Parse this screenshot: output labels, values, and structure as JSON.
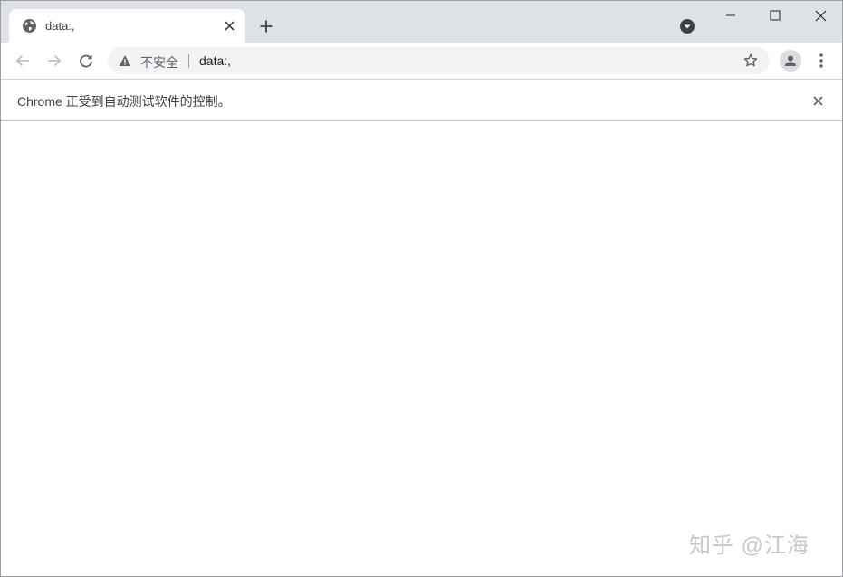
{
  "tab": {
    "title": "data:,",
    "favicon": "globe-icon",
    "close_icon": "close-icon"
  },
  "tabstrip": {
    "new_tab_icon": "plus-icon",
    "tab_search_icon": "chevron-down-circle-icon"
  },
  "window_controls": {
    "minimize_icon": "minimize-icon",
    "maximize_icon": "maximize-icon",
    "close_icon": "close-icon"
  },
  "toolbar": {
    "back_icon": "arrow-left-icon",
    "forward_icon": "arrow-right-icon",
    "reload_icon": "reload-icon",
    "security_icon": "warning-icon",
    "security_label": "不安全",
    "url": "data:,",
    "bookmark_icon": "star-icon",
    "profile_icon": "person-icon",
    "menu_icon": "kebab-menu-icon"
  },
  "infobar": {
    "message": "Chrome 正受到自动测试软件的控制。",
    "close_icon": "close-icon"
  },
  "watermark": {
    "text": "知乎 @江海"
  },
  "colors": {
    "tabstrip_bg": "#dee1e6",
    "omnibox_bg": "#f1f3f4",
    "icon_gray": "#5f6368",
    "text_dark": "#202124"
  }
}
